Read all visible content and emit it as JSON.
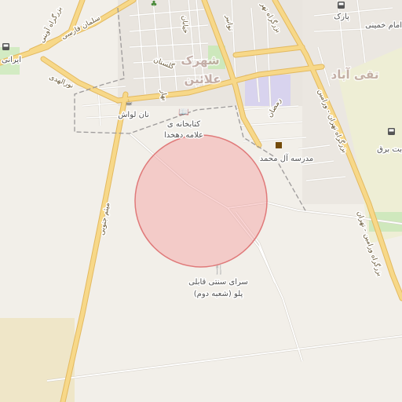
{
  "map": {
    "district_labels": {
      "shahrak": "شهرک",
      "alanin": "علائین",
      "taqi_abad": "تقی آباد"
    },
    "road_labels": {
      "salman_farsi": "سلمان فارسی",
      "bozorgrah_avini": "بزرگراه آوینی",
      "niyam_jenubi": "میثم جنوبی",
      "nooralhoda": "نورالهدی",
      "tehran_varamin": "بزرگراه تهران - ورامین",
      "varamin_tehran": "بزرگراه ورامین - تهران",
      "bozorgrah_nw": "بزرگراه تهر",
      "golestan": "گلستان",
      "ramzan": "رمضان",
      "bahar": "بهار",
      "tavanir": "توانیر",
      "khiyaban": "خیابان"
    },
    "poi_labels": {
      "ketabkhane_1": "کتابخانه ی",
      "ketabkhane_2": "علامه دهخدا",
      "nanlavash": "نان لواش",
      "madrese": "مدرسه آل محمد",
      "park": "پارک",
      "imam": "امام خمینی",
      "bargh": "بت برق",
      "restaurant_1": "سرای سنتی قابلی",
      "restaurant_2": "پلو (شعبه دوم)",
      "iranian": "ایرانی"
    },
    "icons": [
      "bus-icon",
      "bus-icon",
      "bus-icon",
      "book-icon",
      "school-icon",
      "cafe-icon",
      "restaurant-icon",
      "tree-icon"
    ],
    "colors": {
      "background": "#f2efe9",
      "major_road": "#f7d889",
      "major_road_casing": "#e3b95f",
      "minor_road": "#ffffff",
      "minor_road_casing": "#d5d0c8",
      "circle_fill": "#f3a0a0",
      "circle_stroke": "#e07a7a",
      "boundary": "#9d9a9a",
      "residential": "#e6e2dc",
      "park": "#c9e6b7",
      "industrial": "#eddfb0",
      "campus": "#d3cfee",
      "farmland": "#eeeed2"
    }
  }
}
